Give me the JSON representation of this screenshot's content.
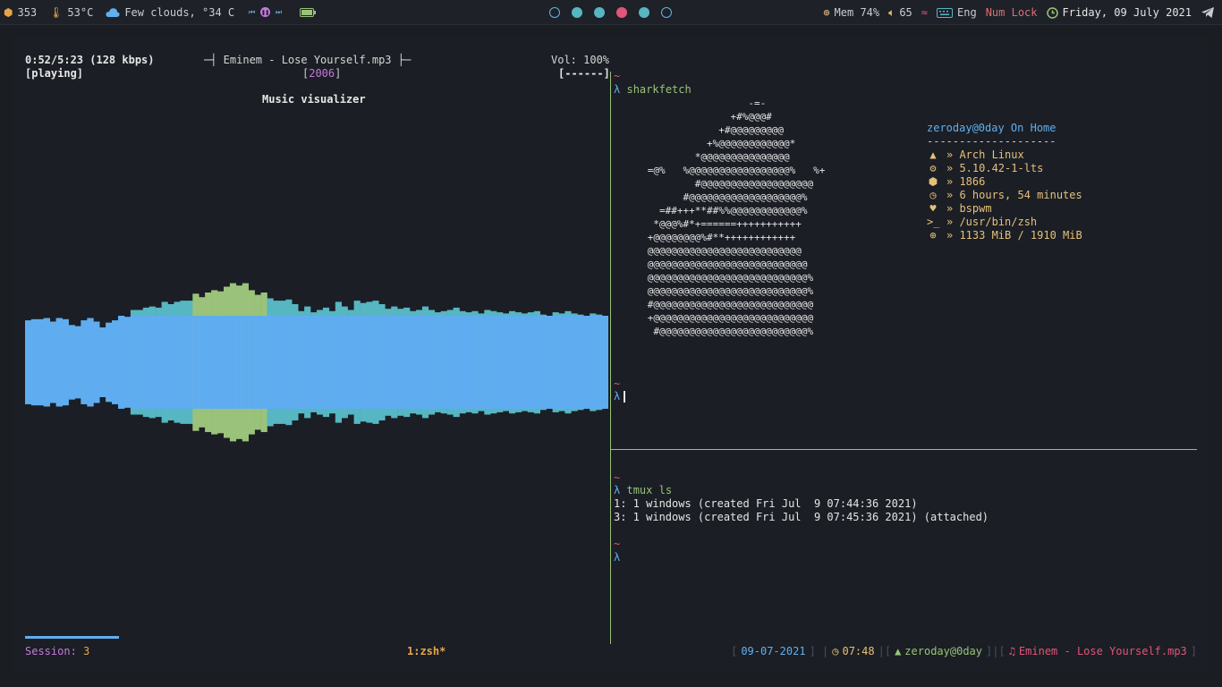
{
  "topbar": {
    "packages": "353",
    "temperature": "53°C",
    "weather": "Few clouds, °34 C",
    "memory": "Mem 74%",
    "volume": "65",
    "keyboard": "Eng",
    "numlock": "Num Lock",
    "clock": "Friday, 09 July 2021",
    "workspaces": [
      "empty",
      "full",
      "full",
      "active",
      "full",
      "empty"
    ]
  },
  "player": {
    "time": "0:52/5:23 (128 kbps)",
    "status": "[playing]",
    "track": "─┤ Eminem - Lose Yourself.mp3 ├─",
    "year": "2006",
    "volume": "Vol: 100%",
    "volume_bar": "[------]",
    "visualizer_title": "Music visualizer",
    "session_label": "Session:",
    "session_value": "3",
    "levels": [
      0.36,
      0.37,
      0.37,
      0.38,
      0.35,
      0.38,
      0.37,
      0.32,
      0.31,
      0.36,
      0.38,
      0.35,
      0.3,
      0.34,
      0.36,
      0.4,
      0.39,
      0.45,
      0.45,
      0.47,
      0.48,
      0.47,
      0.52,
      0.5,
      0.52,
      0.53,
      0.53,
      0.59,
      0.56,
      0.6,
      0.62,
      0.61,
      0.65,
      0.68,
      0.66,
      0.68,
      0.62,
      0.58,
      0.6,
      0.55,
      0.53,
      0.53,
      0.54,
      0.5,
      0.44,
      0.48,
      0.43,
      0.45,
      0.47,
      0.44,
      0.52,
      0.48,
      0.45,
      0.53,
      0.51,
      0.52,
      0.53,
      0.5,
      0.46,
      0.48,
      0.46,
      0.47,
      0.44,
      0.45,
      0.48,
      0.45,
      0.43,
      0.44,
      0.45,
      0.47,
      0.44,
      0.43,
      0.44,
      0.42,
      0.45,
      0.44,
      0.43,
      0.42,
      0.44,
      0.43,
      0.42,
      0.43,
      0.44,
      0.41,
      0.4,
      0.43,
      0.42,
      0.44,
      0.42,
      0.41,
      0.4,
      0.42,
      0.41,
      0.4
    ]
  },
  "terminal": {
    "tilde": "~",
    "lambda": "λ",
    "cmd1": "sharkfetch",
    "cmd3": "tmux ls",
    "tmux_line1": "1: 1 windows (created Fri Jul  9 07:44:36 2021)",
    "tmux_line2": "3: 1 windows (created Fri Jul  9 07:45:36 2021) (attached)"
  },
  "fetch": {
    "user": "zeroday@0day On Home",
    "separator": "--------------------",
    "os": "» Arch Linux",
    "kernel": "» 5.10.42-1-lts",
    "packages": "» 1866",
    "uptime": "» 6 hours, 54 minutes",
    "wm": "» bspwm",
    "shell": "» /usr/bin/zsh",
    "memory": "» 1133 MiB / 1910 MiB",
    "art": [
      "                       -=-",
      "                    +#%@@@#",
      "                  +#@@@@@@@@@",
      "                +%@@@@@@@@@@@@*",
      "              *@@@@@@@@@@@@@@@",
      "      =@%   %@@@@@@@@@@@@@@@@@%   %+",
      "              #@@@@@@@@@@@@@@@@@@@",
      "            #@@@@@@@@@@@@@@@@@@@%",
      "        =##+++**##%%@@@@@@@@@@@@%",
      "       *@@@%#*+======+++++++++++",
      "      +@@@@@@@@%#**++++++++++++",
      "      @@@@@@@@@@@@@@@@@@@@@@@@@@",
      "      @@@@@@@@@@@@@@@@@@@@@@@@@@@",
      "      @@@@@@@@@@@@@@@@@@@@@@@@@@@%",
      "      @@@@@@@@@@@@@@@@@@@@@@@@@@@%",
      "      #@@@@@@@@@@@@@@@@@@@@@@@@@@@",
      "      +@@@@@@@@@@@@@@@@@@@@@@@@@@@",
      "       #@@@@@@@@@@@@@@@@@@@@@@@@@%"
    ]
  },
  "statusline": {
    "window": "1:zsh*",
    "date": "09-07-2021",
    "time": "07:48",
    "user": "zeroday@0day",
    "song": "Eminem - Lose Yourself.mp3"
  }
}
